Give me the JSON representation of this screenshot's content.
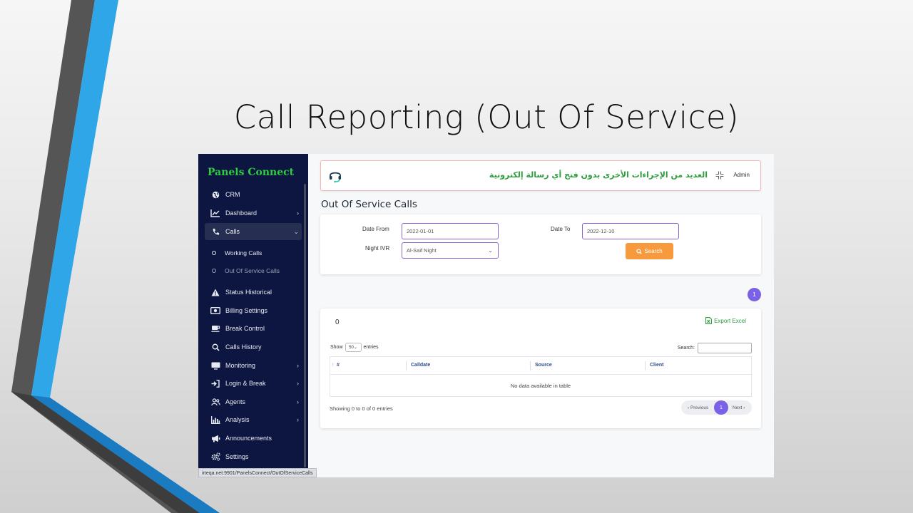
{
  "slide": {
    "title": "Call Reporting (Out Of Service)"
  },
  "sidebar": {
    "brand": "Panels Connect",
    "items": [
      {
        "label": "CRM",
        "icon": "globe-icon"
      },
      {
        "label": "Dashboard",
        "icon": "chart-line-icon"
      },
      {
        "label": "Calls",
        "icon": "phone-icon"
      },
      {
        "label": "Status Historical",
        "icon": "warning-icon"
      },
      {
        "label": "Billing Settings",
        "icon": "money-icon"
      },
      {
        "label": "Break Control",
        "icon": "coffee-icon"
      },
      {
        "label": "Calls History",
        "icon": "search-icon"
      },
      {
        "label": "Monitoring",
        "icon": "monitor-icon"
      },
      {
        "label": "Login & Break",
        "icon": "sign-in-icon"
      },
      {
        "label": "Agents",
        "icon": "users-icon"
      },
      {
        "label": "Analysis",
        "icon": "bar-chart-icon"
      },
      {
        "label": "Announcements",
        "icon": "megaphone-icon"
      },
      {
        "label": "Settings",
        "icon": "gears-icon"
      }
    ],
    "sub_items": [
      {
        "label": "Working Calls"
      },
      {
        "label": "Out Of Service Calls"
      }
    ]
  },
  "status_url": "irteqa.net:9901/PanelsConnect/OutOfServiceCalls",
  "header": {
    "arabic_text": "العديد من الإجراءات الأخرى بدون فتح أي رسالة إلكترونية",
    "user": "Admin"
  },
  "page": {
    "heading": "Out Of Service Calls"
  },
  "filters": {
    "date_from_label": "Date From",
    "date_from_value": "2022-01-01",
    "date_to_label": "Date To",
    "date_to_value": "2022-12-10",
    "night_ivr_label": "Night IVR",
    "night_ivr_value": "Al-Saif Night",
    "search_label": "Search"
  },
  "top_page_number": "1",
  "table": {
    "count": "0",
    "export_label": "Export Excel",
    "show_label": "Show",
    "entries_select": "50",
    "entries_label": "entries",
    "search_label": "Search:",
    "columns": [
      "#",
      "Calldate",
      "Source",
      "Client"
    ],
    "empty_message": "No data available in table",
    "showing": "Showing 0 to 0 of 0 entries",
    "prev_label": "‹ Previous",
    "current_page": "1",
    "next_label": "Next ›"
  },
  "colors": {
    "sidebar_bg": "#0c1640",
    "brand_green": "#2ecc40",
    "accent_purple": "#7b61e8",
    "search_orange": "#f79a3e",
    "stripe_blue": "#2ea6e8"
  }
}
